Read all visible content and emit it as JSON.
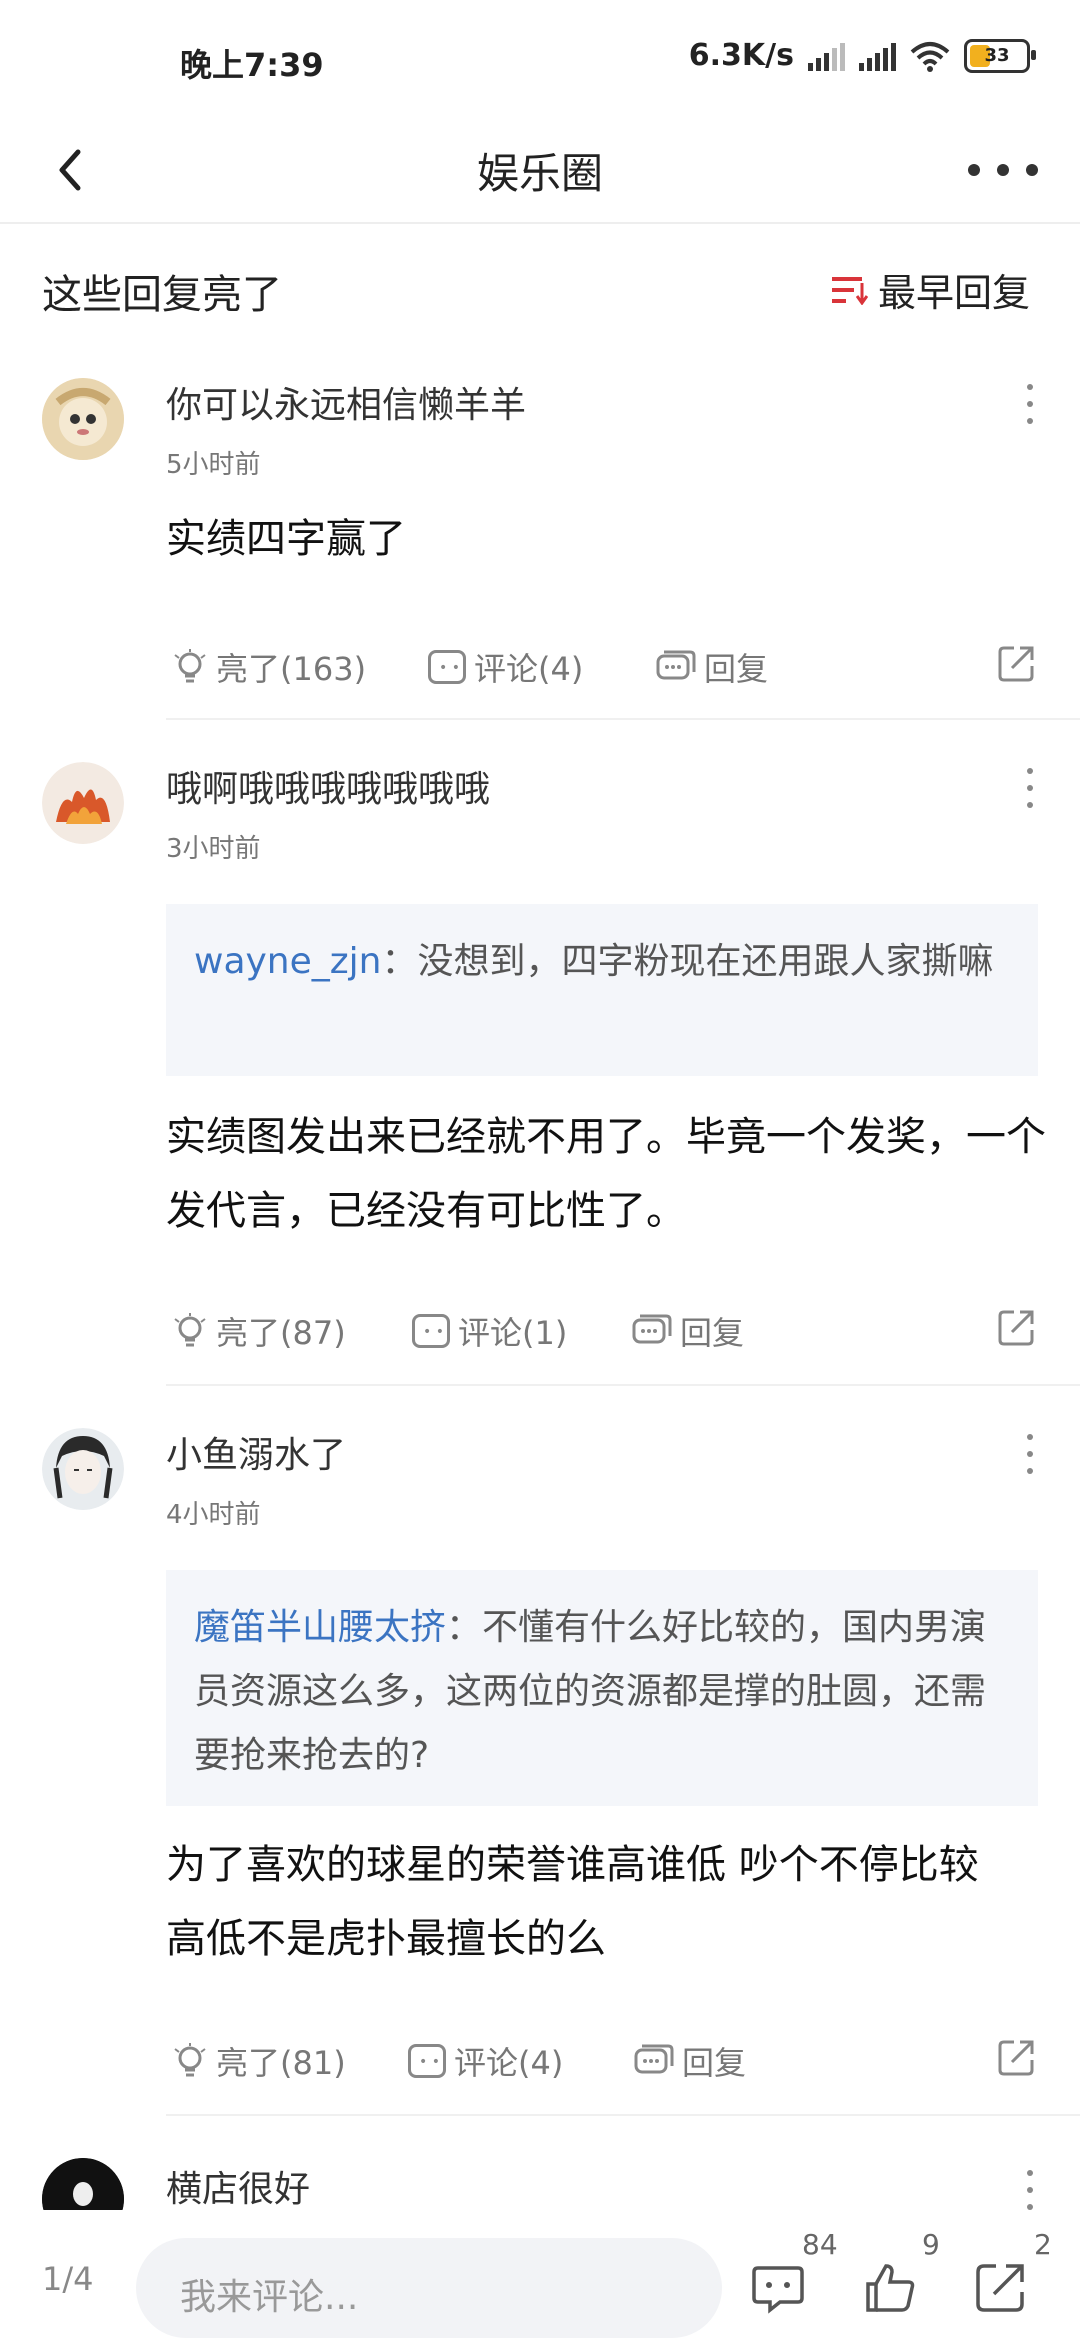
{
  "status_bar": {
    "time": "晚上7:39",
    "net_speed": "6.3K/s",
    "battery": "33"
  },
  "nav": {
    "title": "娱乐圈"
  },
  "section": {
    "label": "这些回复亮了",
    "sort_label": "最早回复"
  },
  "posts": [
    {
      "username": "你可以永远相信懒羊羊",
      "time": "5小时前",
      "quote": null,
      "body": "实绩四字赢了",
      "likes": "亮了(163)",
      "comments": "评论(4)",
      "reply": "回复"
    },
    {
      "username": "哦啊哦哦哦哦哦哦哦",
      "time": "3小时前",
      "quote": {
        "name": "wayne_zjn",
        "text": "：没想到，四字粉现在还用跟人家撕嘛"
      },
      "body": "实绩图发出来已经就不用了。毕竟一个发奖，一个发代言，已经没有可比性了。",
      "likes": "亮了(87)",
      "comments": "评论(1)",
      "reply": "回复"
    },
    {
      "username": "小鱼溺水了",
      "time": "4小时前",
      "quote": {
        "name": "魔笛半山腰太挤",
        "text": "：不懂有什么好比较的，国内男演员资源这么多，这两位的资源都是撑的肚圆，还需要抢来抢去的?"
      },
      "body": "为了喜欢的球星的荣誉谁高谁低 吵个不停比较高低不是虎扑最擅长的么",
      "likes": "亮了(81)",
      "comments": "评论(4)",
      "reply": "回复"
    },
    {
      "username": "横店很好"
    }
  ],
  "bottom_bar": {
    "page": "1/4",
    "placeholder": "我来评论...",
    "comment_count": "84",
    "like_count": "9",
    "share_count": "2"
  }
}
